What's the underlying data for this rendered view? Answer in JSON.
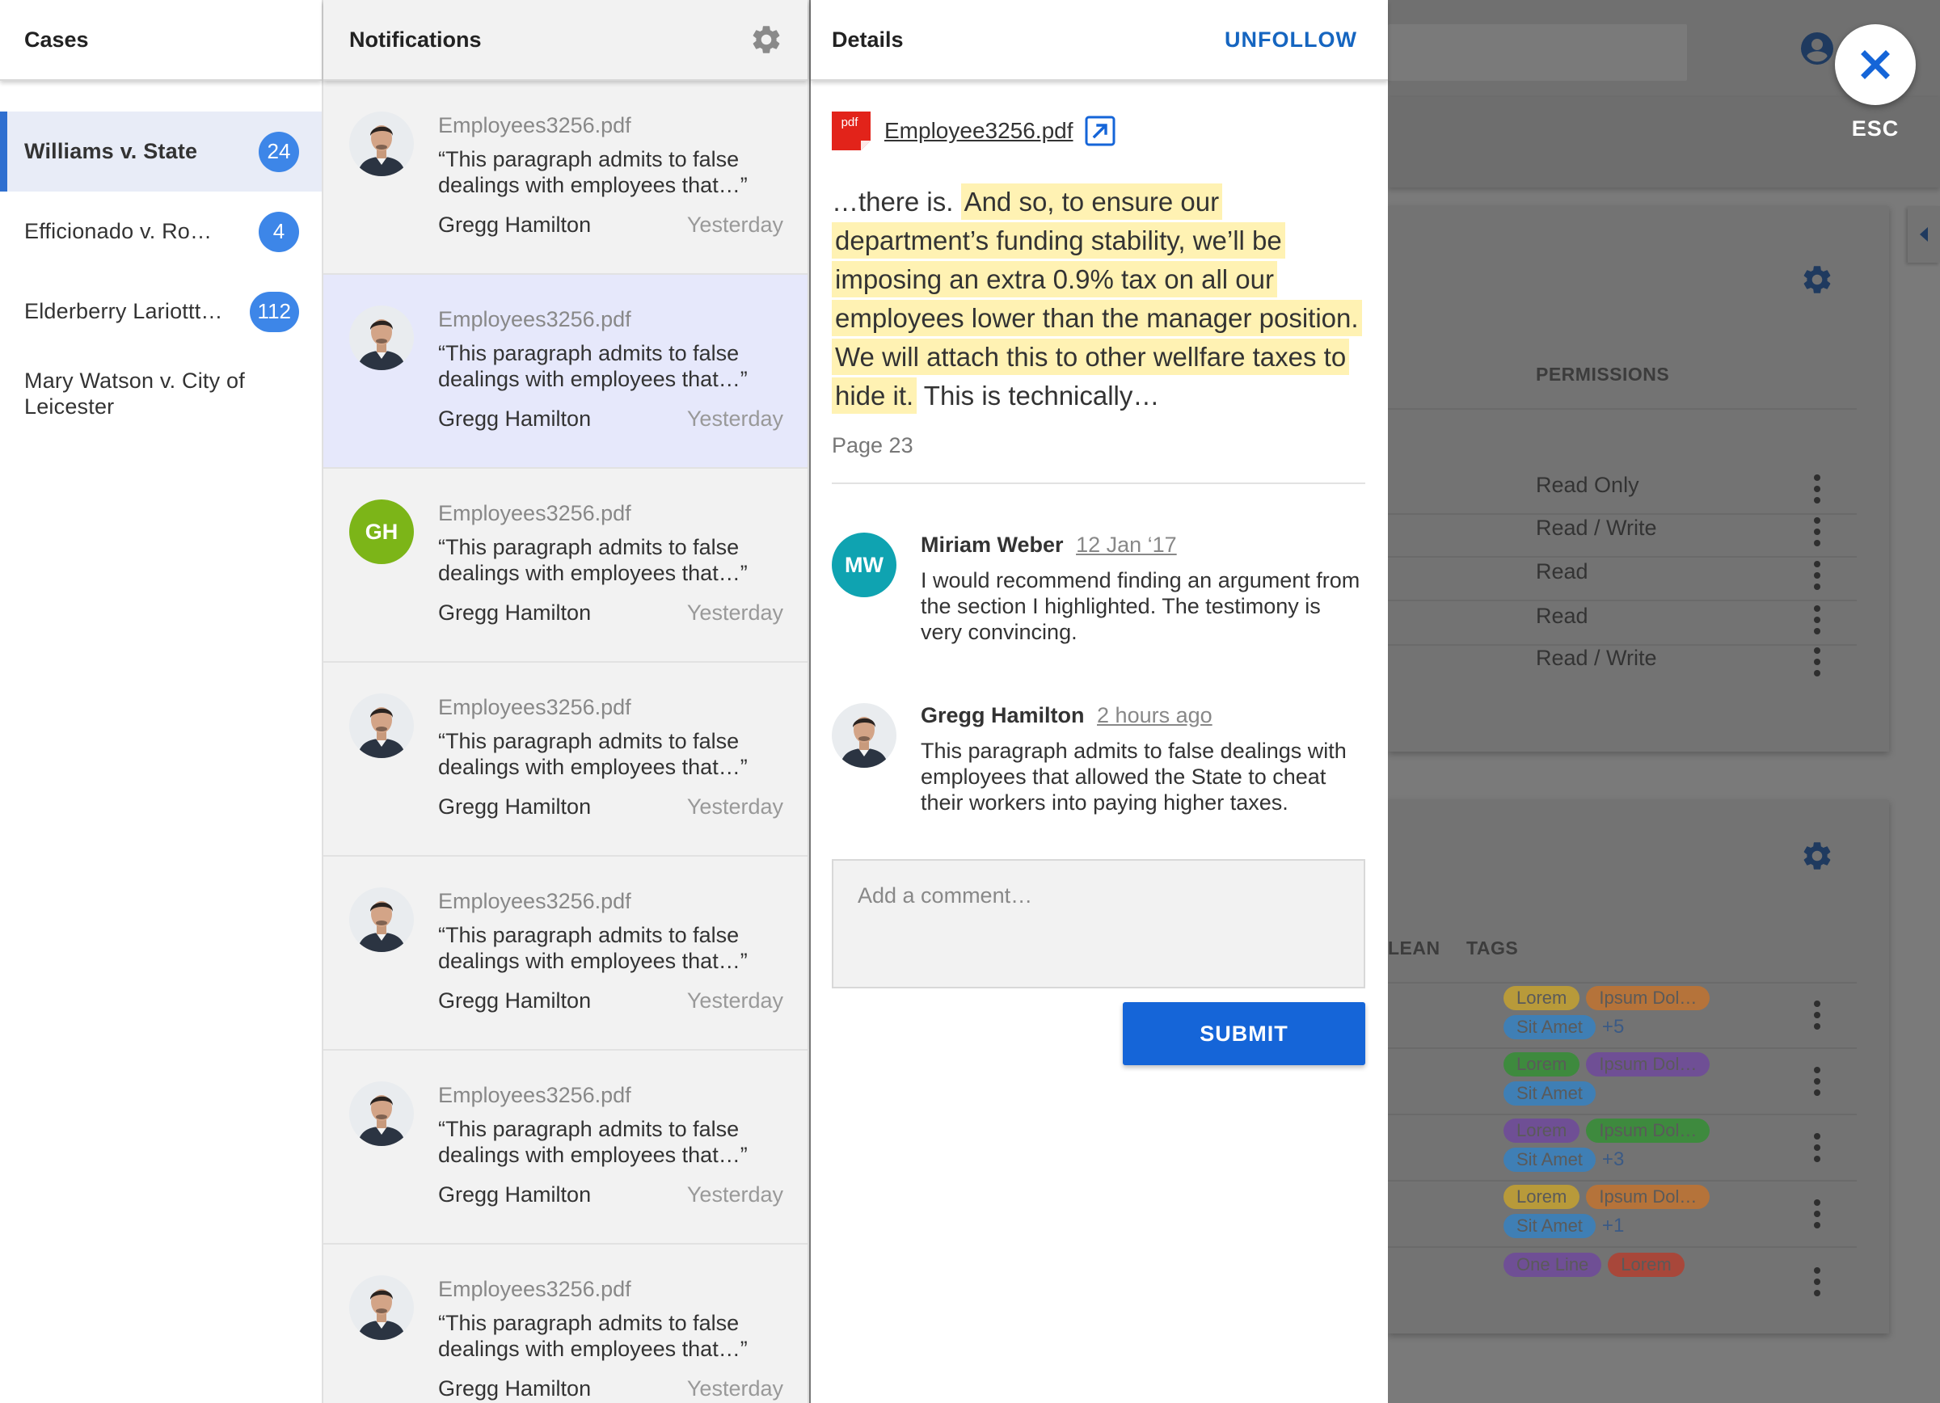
{
  "cases": {
    "title": "Cases",
    "items": [
      {
        "name": "Williams v. State",
        "count": "24",
        "active": true
      },
      {
        "name": "Efficionado v. Ro…",
        "count": "4"
      },
      {
        "name": "Elderberry Lariottt…",
        "count": "112"
      },
      {
        "name": "Mary Watson v. City of Leicester",
        "count": ""
      }
    ]
  },
  "notifications": {
    "title": "Notifications",
    "settings_icon": "gear-icon",
    "items": [
      {
        "file": "Employees3256.pdf",
        "quote": "“This paragraph admits to false dealings with employees that…”",
        "author": "Gregg Hamilton",
        "time": "Yesterday",
        "avatar": "photo"
      },
      {
        "file": "Employees3256.pdf",
        "quote": "“This paragraph admits to false dealings with employees that…”",
        "author": "Gregg Hamilton",
        "time": "Yesterday",
        "avatar": "photo",
        "selected": true
      },
      {
        "file": "Employees3256.pdf",
        "quote": "“This paragraph admits to false dealings with employees that…”",
        "author": "Gregg Hamilton",
        "time": "Yesterday",
        "avatar": "initials",
        "initials": "GH",
        "avatar_color": "#7cb518"
      },
      {
        "file": "Employees3256.pdf",
        "quote": "“This paragraph admits to false dealings with employees that…”",
        "author": "Gregg Hamilton",
        "time": "Yesterday",
        "avatar": "photo"
      },
      {
        "file": "Employees3256.pdf",
        "quote": "“This paragraph admits to false dealings with employees that…”",
        "author": "Gregg Hamilton",
        "time": "Yesterday",
        "avatar": "photo"
      },
      {
        "file": "Employees3256.pdf",
        "quote": "“This paragraph admits to false dealings with employees that…”",
        "author": "Gregg Hamilton",
        "time": "Yesterday",
        "avatar": "photo"
      },
      {
        "file": "Employees3256.pdf",
        "quote": "“This paragraph admits to false dealings with employees that…”",
        "author": "Gregg Hamilton",
        "time": "Yesterday",
        "avatar": "photo"
      }
    ]
  },
  "details": {
    "title": "Details",
    "unfollow_label": "UNFOLLOW",
    "document": {
      "file_type": "pdf",
      "name": "Employee3256.pdf"
    },
    "excerpt": {
      "before": "…there is. ",
      "highlight": "And so, to ensure our department’s funding stability, we’ll be imposing an extra 0.9% tax on all our employees lower than the manager position. We will attach this to other wellfare taxes to hide it.",
      "after": " This is technically…"
    },
    "page_ref": "Page 23",
    "comments": [
      {
        "author": "Miriam Weber",
        "time": "12 Jan ‘17",
        "text": "I would recommend finding an argument from the section I highlighted. The testimony is very convincing.",
        "initials": "MW",
        "avatar_color": "#0fa3b1"
      },
      {
        "author": "Gregg Hamilton",
        "time": "2 hours ago",
        "text": "This paragraph admits to false dealings with employees that allowed the State to cheat their workers into paying higher taxes."
      }
    ],
    "comment_placeholder": "Add a comment…",
    "submit_label": "SUBMIT"
  },
  "background": {
    "permissions_header": "PERMISSIONS",
    "permissions": [
      "Read Only",
      "Read / Write",
      "Read",
      "Read",
      "Read / Write"
    ],
    "boolean_header_partial": "LEAN",
    "tags_header": "TAGS",
    "tag_rows": [
      {
        "line1": [
          {
            "label": "Lorem",
            "color": "#b89a3a"
          },
          {
            "label": "Ipsum Dol…",
            "color": "#b5733a"
          }
        ],
        "line2": [
          {
            "label": "Sit Amet",
            "color": "#3f7fb5"
          }
        ],
        "more": "+5"
      },
      {
        "line1": [
          {
            "label": "Lorem",
            "color": "#3e8a3e"
          },
          {
            "label": "Ipsum Dol…",
            "color": "#6f4f95"
          }
        ],
        "line2": [
          {
            "label": "Sit Amet",
            "color": "#3f7fb5"
          }
        ],
        "more": ""
      },
      {
        "line1": [
          {
            "label": "Lorem",
            "color": "#6f4f95"
          },
          {
            "label": "Ipsum Dol…",
            "color": "#3e8a3e"
          }
        ],
        "line2": [
          {
            "label": "Sit Amet",
            "color": "#3f7fb5"
          }
        ],
        "more": "+3"
      },
      {
        "line1": [
          {
            "label": "Lorem",
            "color": "#b89a3a"
          },
          {
            "label": "Ipsum Dol…",
            "color": "#b5733a"
          }
        ],
        "line2": [
          {
            "label": "Sit Amet",
            "color": "#3f7fb5"
          }
        ],
        "more": "+1"
      },
      {
        "line1": [
          {
            "label": "One Line",
            "color": "#6f4f95"
          },
          {
            "label": "Lorem",
            "color": "#a8473a"
          }
        ],
        "line2": [],
        "more": ""
      }
    ]
  },
  "close": {
    "icon": "close-icon",
    "label": "ESC"
  }
}
